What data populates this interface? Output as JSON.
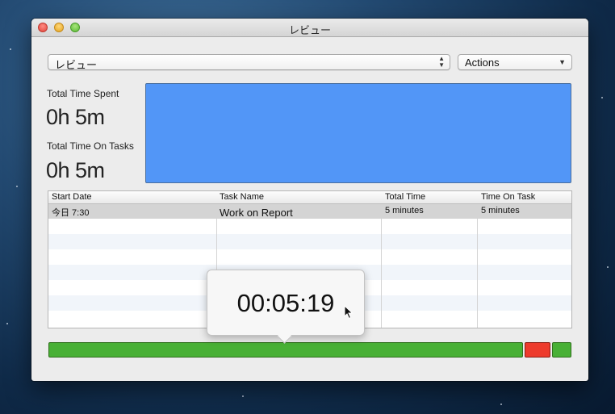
{
  "window": {
    "title": "レビュー"
  },
  "toolbar": {
    "review_select": "レビュー",
    "actions_label": "Actions"
  },
  "stats": {
    "total_time_spent_label": "Total Time Spent",
    "total_time_spent_value": "0h 5m",
    "total_time_on_tasks_label": "Total Time On Tasks",
    "total_time_on_tasks_value": "0h 5m"
  },
  "table": {
    "columns": [
      "Start Date",
      "Task Name",
      "Total Time",
      "Time On Task"
    ],
    "rows": [
      {
        "start_date": "今日 7:30",
        "task_name": "Work on Report",
        "total_time": "5 minutes",
        "time_on_task": "5 minutes"
      }
    ]
  },
  "popover": {
    "elapsed": "00:05:19"
  },
  "timeline": {
    "segments": [
      {
        "status": "green",
        "color": "#48b035"
      },
      {
        "status": "red",
        "color": "#ed3b2c"
      },
      {
        "status": "green",
        "color": "#48b035"
      }
    ]
  },
  "colors": {
    "graph": "#5296f7",
    "selected_row": "#d4d4d4"
  },
  "icons": [
    "close-icon",
    "minimize-icon",
    "zoom-icon",
    "up-down-chevron-icon",
    "chevron-down-icon",
    "mouse-pointer-icon"
  ]
}
